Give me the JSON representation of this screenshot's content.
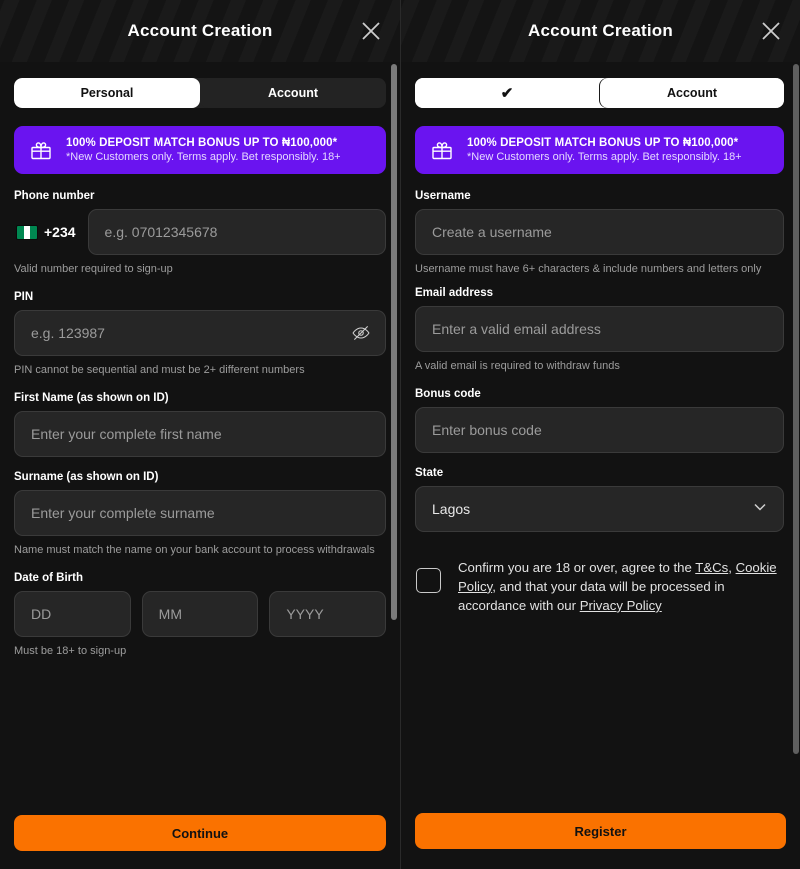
{
  "left": {
    "header": {
      "title": "Account Creation",
      "close_icon": "close-icon"
    },
    "tabs": [
      {
        "label": "Personal",
        "active": true
      },
      {
        "label": "Account",
        "active": false
      }
    ],
    "promo": {
      "icon": "gift-icon",
      "title": "100% DEPOSIT MATCH BONUS UP TO ₦100,000*",
      "subtitle": "*New Customers only. Terms apply. Bet responsibly. 18+",
      "background_color": "#6a14f0"
    },
    "phone": {
      "label": "Phone number",
      "flag_icon": "nigeria-flag-icon",
      "dial_code": "+234",
      "placeholder": "e.g. 07012345678",
      "value": "",
      "hint": "Valid number required to sign-up"
    },
    "pin": {
      "label": "PIN",
      "placeholder": "e.g. 123987",
      "value": "",
      "hint": "PIN cannot be sequential and must be 2+ different numbers",
      "toggle_icon": "eye-off-icon"
    },
    "first_name": {
      "label": "First Name (as shown on ID)",
      "placeholder": "Enter your complete first name",
      "value": ""
    },
    "surname": {
      "label": "Surname (as shown on ID)",
      "placeholder": "Enter your complete surname",
      "value": "",
      "hint": "Name must match the name on your bank account to process withdrawals"
    },
    "dob": {
      "label": "Date of Birth",
      "day_placeholder": "DD",
      "month_placeholder": "MM",
      "year_placeholder": "YYYY",
      "day_value": "",
      "month_value": "",
      "year_value": "",
      "hint": "Must be 18+ to sign-up"
    },
    "cta": {
      "label": "Continue",
      "color": "#fa7200"
    }
  },
  "right": {
    "header": {
      "title": "Account Creation",
      "close_icon": "close-icon"
    },
    "tabs": [
      {
        "label": "✔",
        "icon": "check-icon",
        "active": true,
        "completed": true
      },
      {
        "label": "Account",
        "active": true
      }
    ],
    "promo": {
      "icon": "gift-icon",
      "title": "100% DEPOSIT MATCH BONUS UP TO ₦100,000*",
      "subtitle": "*New Customers only. Terms apply. Bet responsibly. 18+",
      "background_color": "#6a14f0"
    },
    "username": {
      "label": "Username",
      "placeholder": "Create a username",
      "value": "",
      "hint": "Username must have 6+ characters & include numbers and letters only"
    },
    "email": {
      "label": "Email address",
      "placeholder": "Enter a valid email address",
      "value": "",
      "hint": "A valid email is required to withdraw funds"
    },
    "bonus_code": {
      "label": "Bonus code",
      "placeholder": "Enter bonus code",
      "value": ""
    },
    "state": {
      "label": "State",
      "value": "Lagos",
      "chevron_icon": "chevron-down-icon"
    },
    "consent": {
      "checked": false,
      "part1": "Confirm you are 18 or over, agree to the ",
      "link1": "T&Cs",
      "part2": ", ",
      "link2": "Cookie Policy",
      "part3": ", and that your data will be processed in accordance with our ",
      "link3": "Privacy Policy"
    },
    "cta": {
      "label": "Register",
      "color": "#fa7200"
    }
  }
}
